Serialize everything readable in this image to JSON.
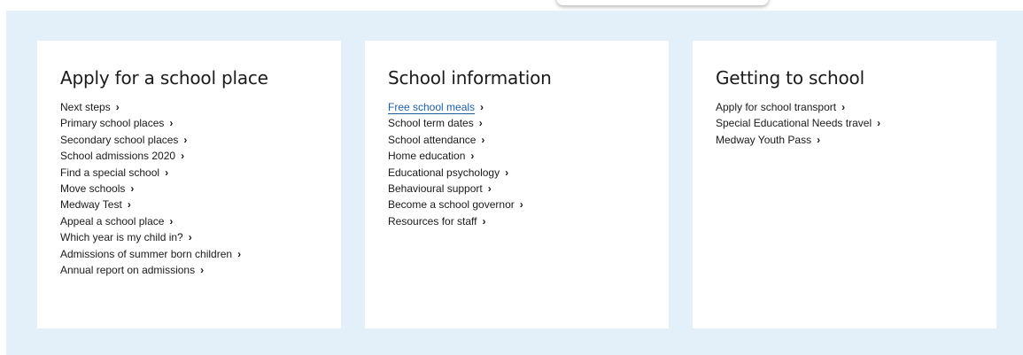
{
  "columns": [
    {
      "title": "Apply for a school place",
      "links": [
        {
          "label": "Next steps"
        },
        {
          "label": "Primary school places"
        },
        {
          "label": "Secondary school places"
        },
        {
          "label": "School admissions 2020"
        },
        {
          "label": "Find a special school"
        },
        {
          "label": "Move schools"
        },
        {
          "label": "Medway Test"
        },
        {
          "label": "Appeal a school place"
        },
        {
          "label": "Which year is my child in?"
        },
        {
          "label": "Admissions of summer born children"
        },
        {
          "label": "Annual report on admissions"
        }
      ]
    },
    {
      "title": "School information",
      "links": [
        {
          "label": "Free school meals"
        },
        {
          "label": "School term dates"
        },
        {
          "label": "School attendance"
        },
        {
          "label": "Home education"
        },
        {
          "label": "Educational psychology"
        },
        {
          "label": "Behavioural support"
        },
        {
          "label": "Become a school governor"
        },
        {
          "label": "Resources for staff"
        }
      ]
    },
    {
      "title": "Getting to school",
      "links": [
        {
          "label": "Apply for school transport"
        },
        {
          "label": "Special Educational Needs travel"
        },
        {
          "label": "Medway Youth Pass"
        }
      ]
    }
  ],
  "chevron_icon": "chevron-right-icon",
  "colors": {
    "section_bg": "#e3f0fa",
    "card_bg": "#ffffff",
    "active_link": "#1d5e9e",
    "text": "#1a1a1a"
  }
}
